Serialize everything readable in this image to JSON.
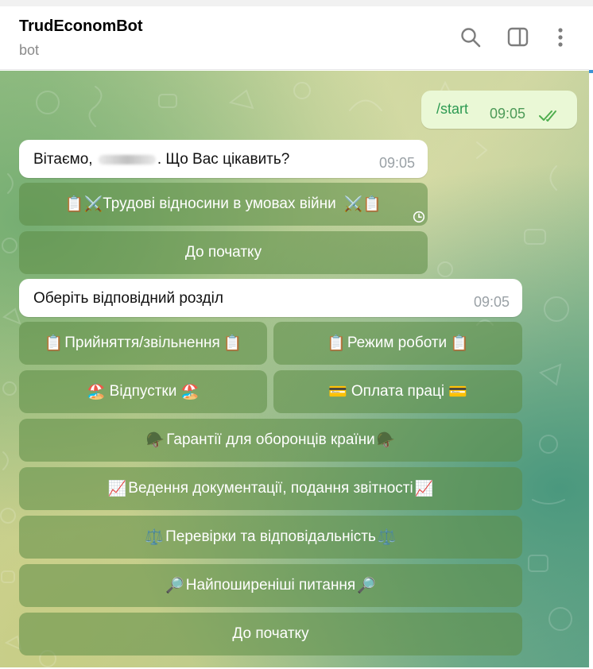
{
  "header": {
    "title": "TrudEconomBot",
    "subtitle": "bot",
    "icons": [
      "search-icon",
      "sidebar-icon",
      "more-vertical-icon"
    ]
  },
  "colors": {
    "outgoing_bubble": "#eaf8d6",
    "incoming_bubble": "#ffffff",
    "keyboard_button": "#5c8c46",
    "accent": "#3b93d6"
  },
  "messages": {
    "outgoing": {
      "text": "/start",
      "time": "09:05",
      "status": "read"
    },
    "greeting": {
      "text_before": "Вітаємо,",
      "text_after": ". Що Вас цікавить?",
      "time": "09:05"
    },
    "section": {
      "text": "Оберіть відповідний розділ",
      "time": "09:05"
    }
  },
  "keyboard1": {
    "labor_relations": {
      "emoji_left": "📋⚔️",
      "label": "Трудові відносини в умовах війни",
      "emoji_right": "⚔️📋"
    },
    "to_start": {
      "label": "До початку"
    }
  },
  "keyboard2": {
    "hiring": {
      "emoji_left": "📋",
      "label": "Прийняття/звільнення",
      "emoji_right": "📋"
    },
    "work_mode": {
      "emoji_left": "📋",
      "label": "Режим роботи",
      "emoji_right": "📋"
    },
    "vacations": {
      "emoji_left": "🏖️",
      "label": "Відпустки",
      "emoji_right": "🏖️"
    },
    "payment": {
      "emoji_left": "💳",
      "label": "Оплата праці",
      "emoji_right": "💳"
    },
    "defenders": {
      "emoji_left": "🪖",
      "label": "Гарантії для оборонців країни",
      "emoji_right": "🪖"
    },
    "documentation": {
      "emoji_left": "📈",
      "label": "Ведення документації, подання звітності",
      "emoji_right": "📈"
    },
    "inspections": {
      "emoji_left": "⚖️",
      "label": "Перевірки та відповідальність",
      "emoji_right": "⚖️"
    },
    "faq": {
      "emoji_left": "🔎",
      "label": "Найпоширеніші питання",
      "emoji_right": "🔎"
    },
    "to_start": {
      "label": "До початку"
    }
  }
}
